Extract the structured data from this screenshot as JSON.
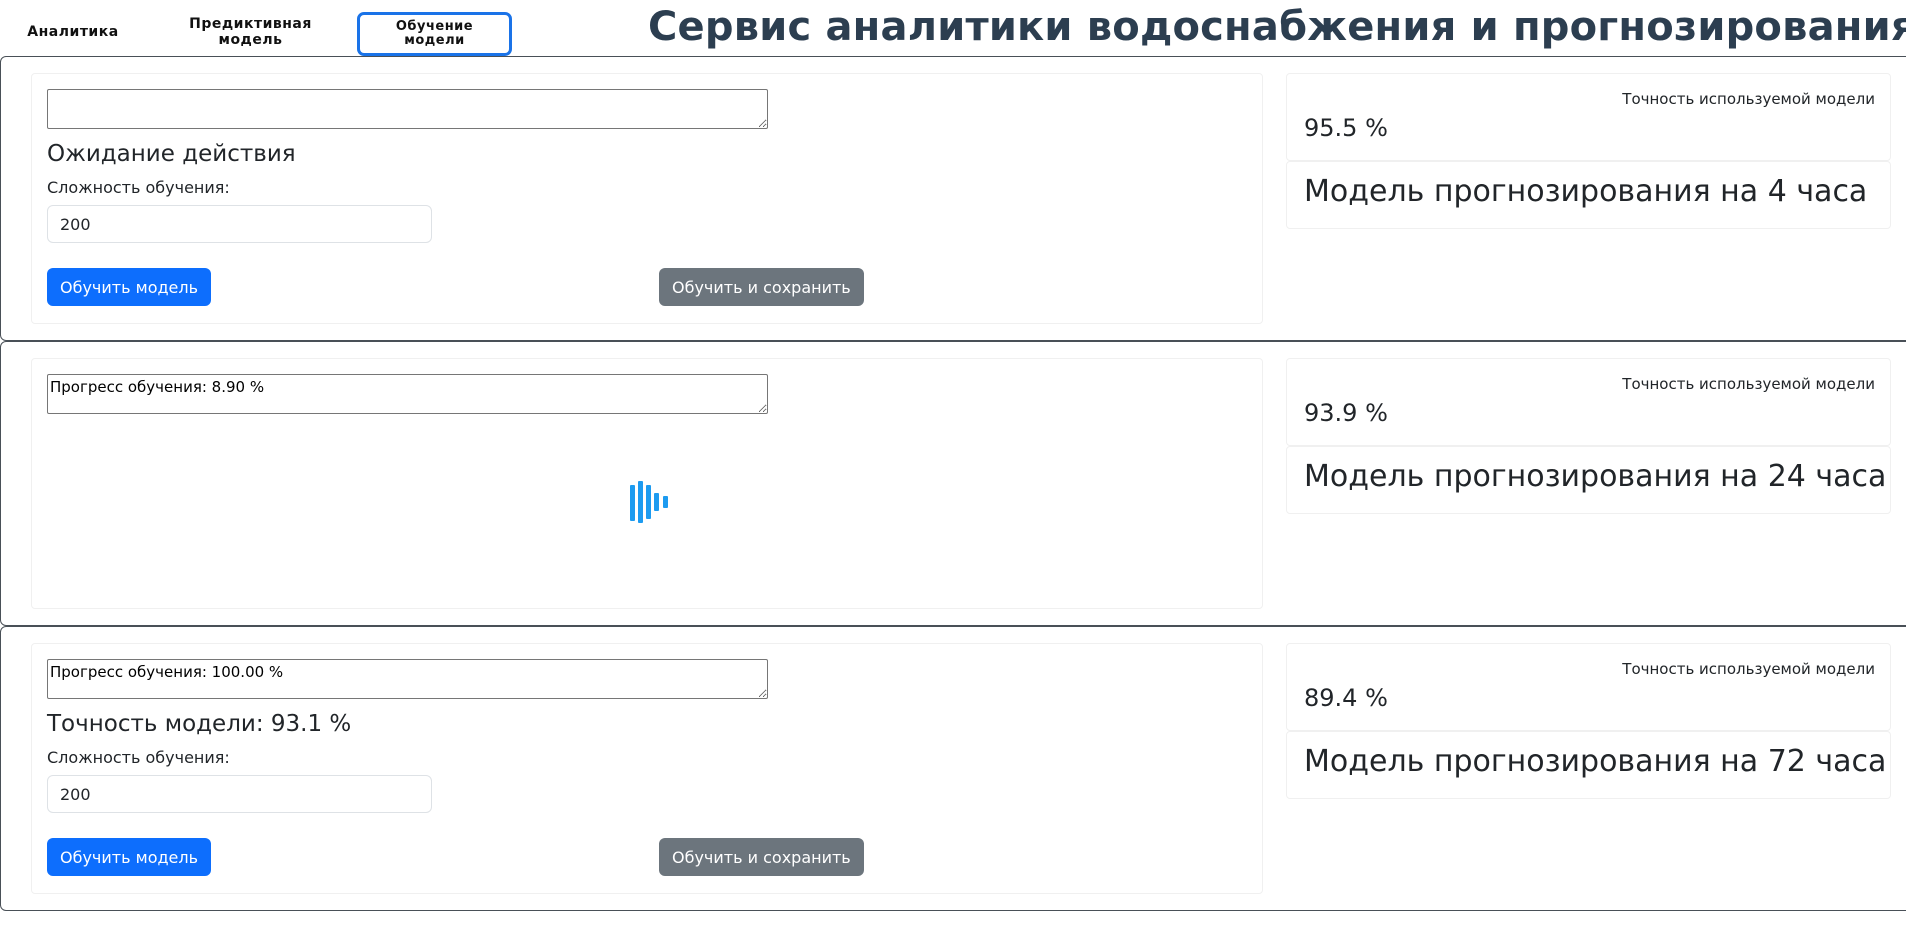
{
  "nav": {
    "analytics": "Аналитика",
    "predictive": "Предиктивная\nмодель",
    "training": "Обучение\nмодели"
  },
  "app_title": "Сервис аналитики водоснабжения и прогнозирования",
  "sections": [
    {
      "log": "",
      "status": "Ожидание действия",
      "complexity_label": "Сложность обучения:",
      "complexity_value": "200",
      "train_button": "Обучить модель",
      "train_save_button": "Обучить и сохранить",
      "accuracy_label": "Точность используемой модели",
      "accuracy_value": "95.5 %",
      "model_title": "Модель прогнозирования на 4 часа"
    },
    {
      "log": "Прогресс обучения: 8.90 %",
      "loading": true,
      "accuracy_label": "Точность используемой модели",
      "accuracy_value": "93.9 %",
      "model_title": "Модель прогнозирования на 24 часа"
    },
    {
      "log": "Прогресс обучения: 100.00 %",
      "status": "Точность модели: 93.1 %",
      "complexity_label": "Сложность обучения:",
      "complexity_value": "200",
      "train_button": "Обучить модель",
      "train_save_button": "Обучить и сохранить",
      "accuracy_label": "Точность используемой модели",
      "accuracy_value": "89.4 %",
      "model_title": "Модель прогнозирования на 72 часа"
    }
  ],
  "colors": {
    "primary": "#0d6efd",
    "secondary": "#6c757d",
    "title": "#2c3e50",
    "active_tab_border": "#1a73e8",
    "spinner": "#1d9bf0"
  }
}
